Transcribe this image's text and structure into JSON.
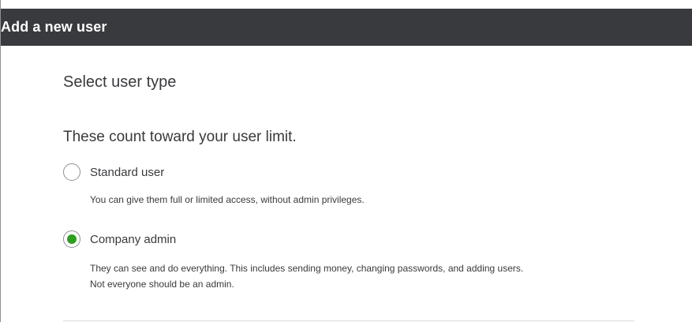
{
  "dialog": {
    "title": "Add a new user"
  },
  "section": {
    "title": "Select user type",
    "subheading": "These count toward your user limit."
  },
  "options": [
    {
      "label": "Standard user",
      "description": "You can give them full or limited access, without admin privileges.",
      "selected": false
    },
    {
      "label": "Company admin",
      "description_line1": "They can see and do everything. This includes sending money, changing passwords, and adding users.",
      "description_line2": "Not everyone should be an admin.",
      "selected": true
    }
  ],
  "colors": {
    "titlebar_bg": "#393a3d",
    "radio_selected": "#2ca01c",
    "text": "#393a3d"
  }
}
